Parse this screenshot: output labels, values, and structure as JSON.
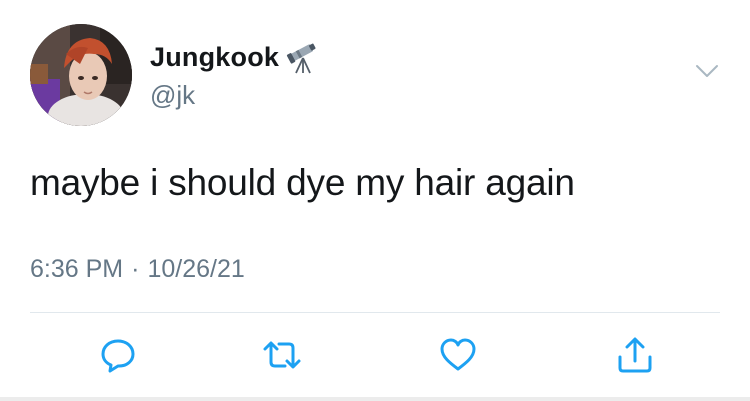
{
  "tweet": {
    "display_name": "Jungkook",
    "display_name_emoji": "telescope-icon",
    "handle": "@jk",
    "text": "maybe i should dye my hair again",
    "time": "6:36 PM",
    "separator": "·",
    "date": "10/26/21"
  },
  "actions": [
    {
      "name": "reply",
      "icon": "speech-bubble-icon"
    },
    {
      "name": "retweet",
      "icon": "retweet-icon"
    },
    {
      "name": "like",
      "icon": "heart-icon"
    },
    {
      "name": "share",
      "icon": "share-icon"
    }
  ],
  "colors": {
    "text": "#14171a",
    "secondary": "#657786",
    "icon": "#1da1f2",
    "divider": "#e1e8ed"
  }
}
